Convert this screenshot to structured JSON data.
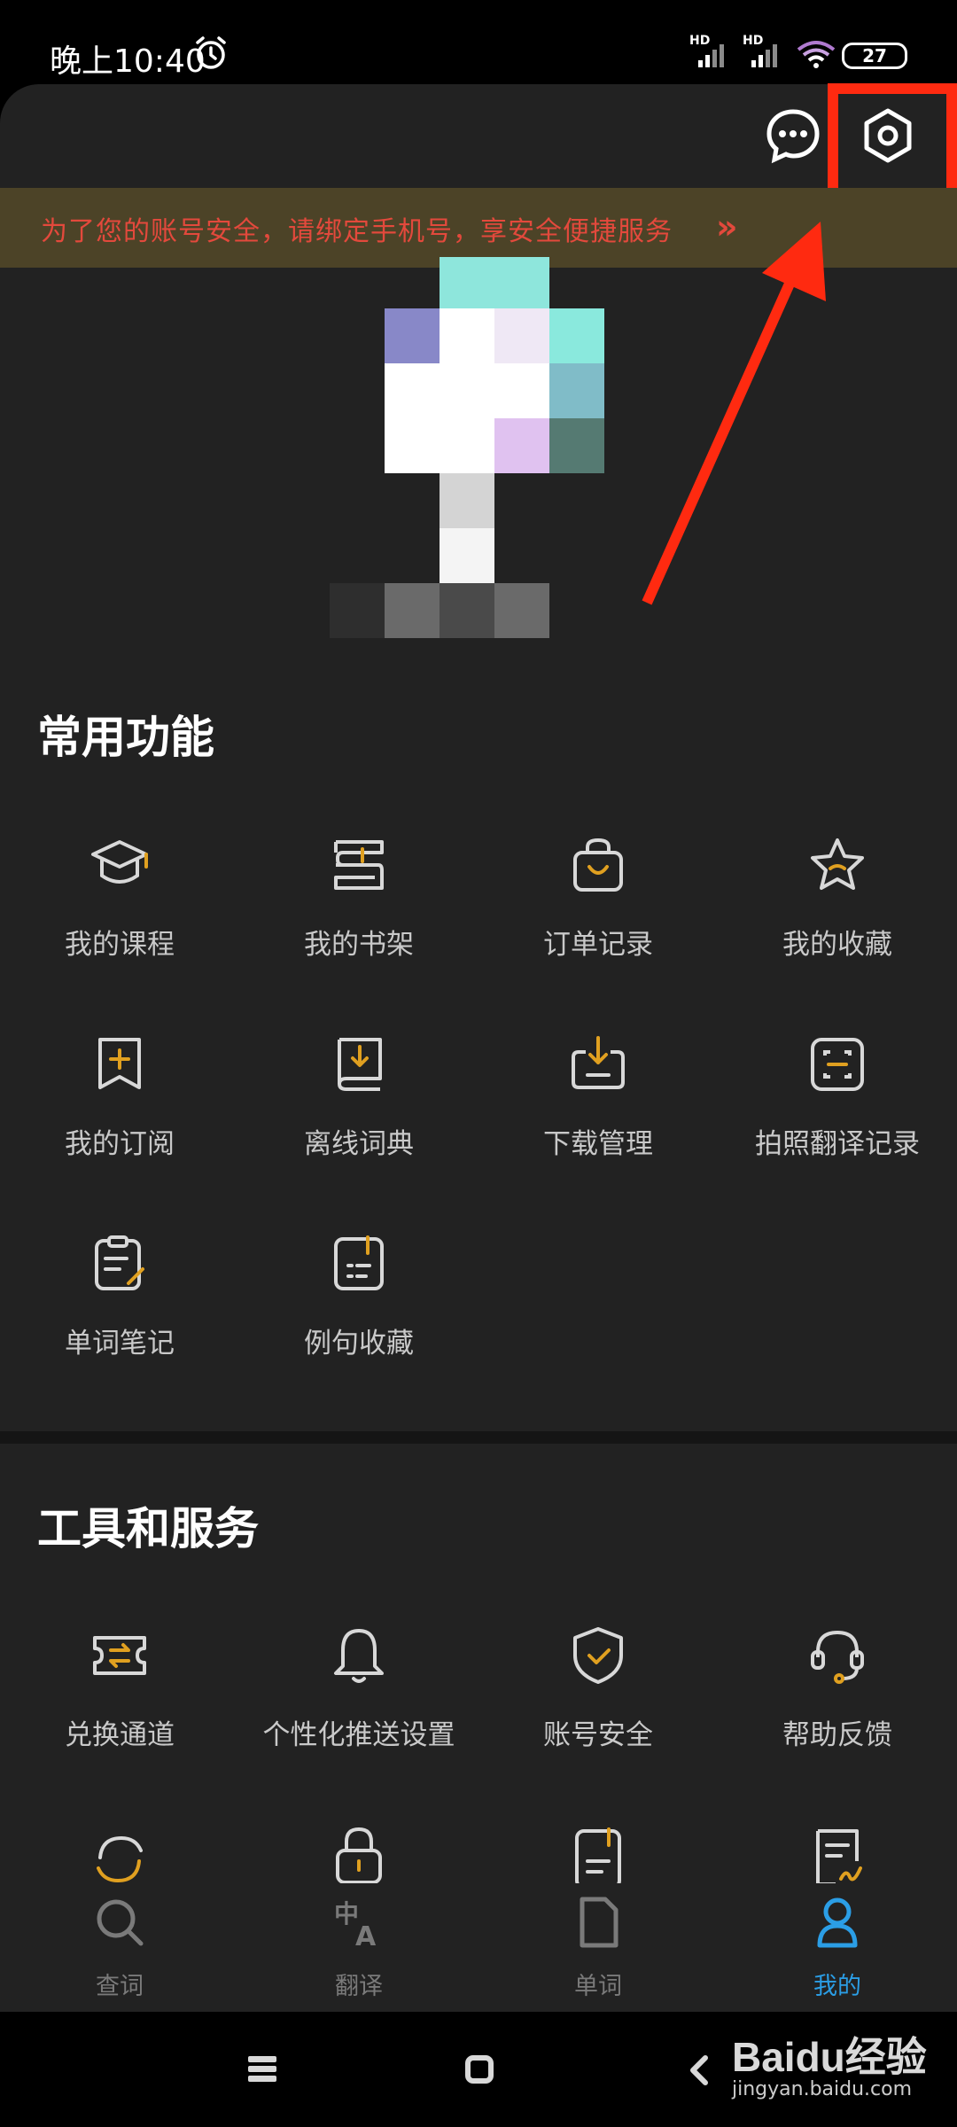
{
  "status_bar": {
    "time": "晚上10:40",
    "hd1": "HD",
    "hd2": "HD",
    "battery": "27"
  },
  "banner": {
    "text": "为了您的账号安全，请绑定手机号，享安全便捷服务"
  },
  "common_functions": {
    "title": "常用功能",
    "items": [
      {
        "label": "我的课程",
        "icon": "graduation-cap-icon"
      },
      {
        "label": "我的书架",
        "icon": "bookshelf-icon"
      },
      {
        "label": "订单记录",
        "icon": "shopping-bag-icon"
      },
      {
        "label": "我的收藏",
        "icon": "star-icon"
      },
      {
        "label": "我的订阅",
        "icon": "bookmark-plus-icon"
      },
      {
        "label": "离线词典",
        "icon": "offline-dictionary-icon"
      },
      {
        "label": "下载管理",
        "icon": "download-tray-icon"
      },
      {
        "label": "拍照翻译记录",
        "icon": "scan-frame-icon"
      },
      {
        "label": "单词笔记",
        "icon": "clipboard-note-icon"
      },
      {
        "label": "例句收藏",
        "icon": "sentence-note-icon"
      }
    ]
  },
  "tools_services": {
    "title": "工具和服务",
    "items": [
      {
        "label": "兑换通道",
        "icon": "exchange-ticket-icon"
      },
      {
        "label": "个性化推送设置",
        "icon": "bell-icon"
      },
      {
        "label": "账号安全",
        "icon": "shield-check-icon"
      },
      {
        "label": "帮助反馈",
        "icon": "headset-icon"
      }
    ]
  },
  "tab_bar": {
    "tabs": [
      {
        "label": "查词",
        "icon": "search-icon",
        "active": false
      },
      {
        "label": "翻译",
        "icon": "translate-icon",
        "active": false
      },
      {
        "label": "单词",
        "icon": "word-file-icon",
        "active": false
      },
      {
        "label": "我的",
        "icon": "person-icon",
        "active": true
      }
    ]
  },
  "watermark": {
    "logo": "Baidu经验",
    "url": "jingyan.baidu.com"
  },
  "colors": {
    "accent": "#e0a020",
    "active_tab": "#2b9ee6",
    "banner_text": "#e3493c",
    "highlight": "#ff2a10"
  }
}
